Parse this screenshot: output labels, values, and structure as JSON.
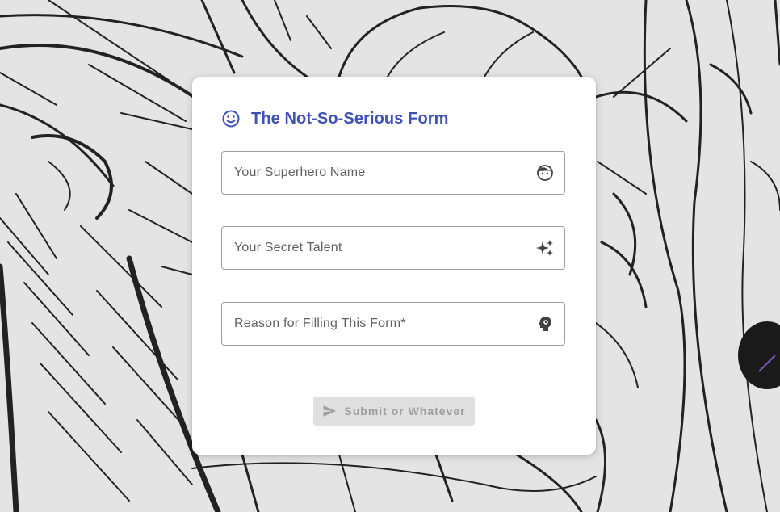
{
  "form": {
    "title": "The Not-So-Serious Form",
    "title_icon": "smiley-face-icon",
    "accent_color": "#3f51b5",
    "fields": [
      {
        "placeholder": "Your Superhero Name",
        "value": "",
        "icon": "face-icon"
      },
      {
        "placeholder": "Your Secret Talent",
        "value": "",
        "icon": "sparkles-icon"
      },
      {
        "placeholder": "Reason for Filling This Form*",
        "value": "",
        "icon": "psychology-head-icon"
      }
    ],
    "submit": {
      "label": "Submit or Whatever",
      "icon": "send-icon",
      "disabled": true
    }
  },
  "background": {
    "description_icon": "manga-sketch-background",
    "color": "#e4e4e4"
  }
}
